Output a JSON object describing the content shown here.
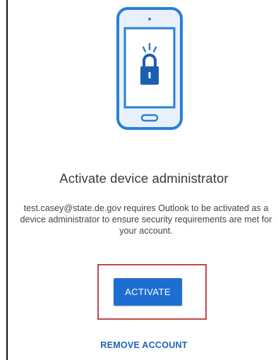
{
  "dialog": {
    "illustration_icon": "phone-lock-icon",
    "title": "Activate device administrator",
    "description": "test.casey@state.de.gov requires Outlook to be activated as a device administrator to ensure security requirements are met for your account.",
    "activate_label": "ACTIVATE",
    "remove_account_label": "REMOVE ACCOUNT"
  },
  "colors": {
    "accent": "#1e6ed2",
    "link": "#1e63b8",
    "highlight": "#c1484c",
    "illustration_blue": "#2a7fd6",
    "illustration_light": "#e8f1fb"
  }
}
